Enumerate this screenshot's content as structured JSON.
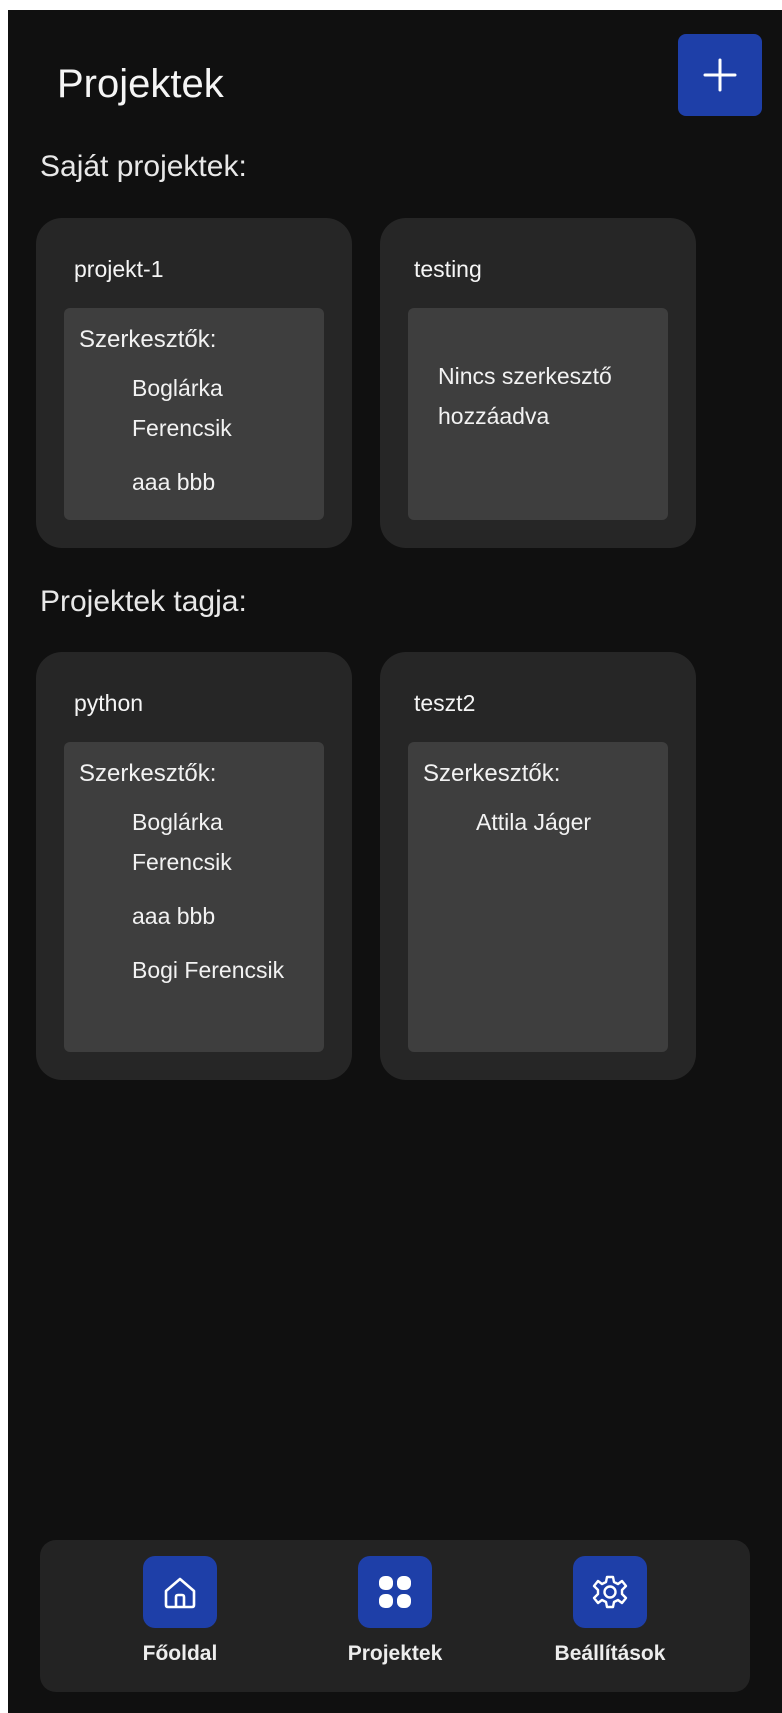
{
  "header": {
    "title": "Projektek",
    "add_icon": "plus-icon"
  },
  "own_projects": {
    "title": "Saját projektek:",
    "cards": [
      {
        "name": "projekt-1",
        "editors_label": "Szerkesztők:",
        "editors": [
          "Boglárka Ferencsik",
          "aaa bbb"
        ]
      },
      {
        "name": "testing",
        "empty_message": "Nincs szerkesztő hozzáadva"
      }
    ]
  },
  "member_projects": {
    "title": "Projektek tagja:",
    "cards": [
      {
        "name": "python",
        "editors_label": "Szerkesztők:",
        "editors": [
          "Boglárka Ferencsik",
          "aaa bbb",
          "Bogi Ferencsik"
        ]
      },
      {
        "name": "teszt2",
        "editors_label": "Szerkesztők:",
        "editors": [
          "Attila Jáger"
        ]
      }
    ]
  },
  "nav": {
    "items": [
      {
        "label": "Főoldal",
        "icon": "home-icon"
      },
      {
        "label": "Projektek",
        "icon": "grid-icon"
      },
      {
        "label": "Beállítások",
        "icon": "gear-icon"
      }
    ]
  },
  "colors": {
    "background": "#101010",
    "card": "#262626",
    "inner_panel": "#3e3e3e",
    "accent": "#1e3fa8",
    "nav_bar": "#232323"
  }
}
